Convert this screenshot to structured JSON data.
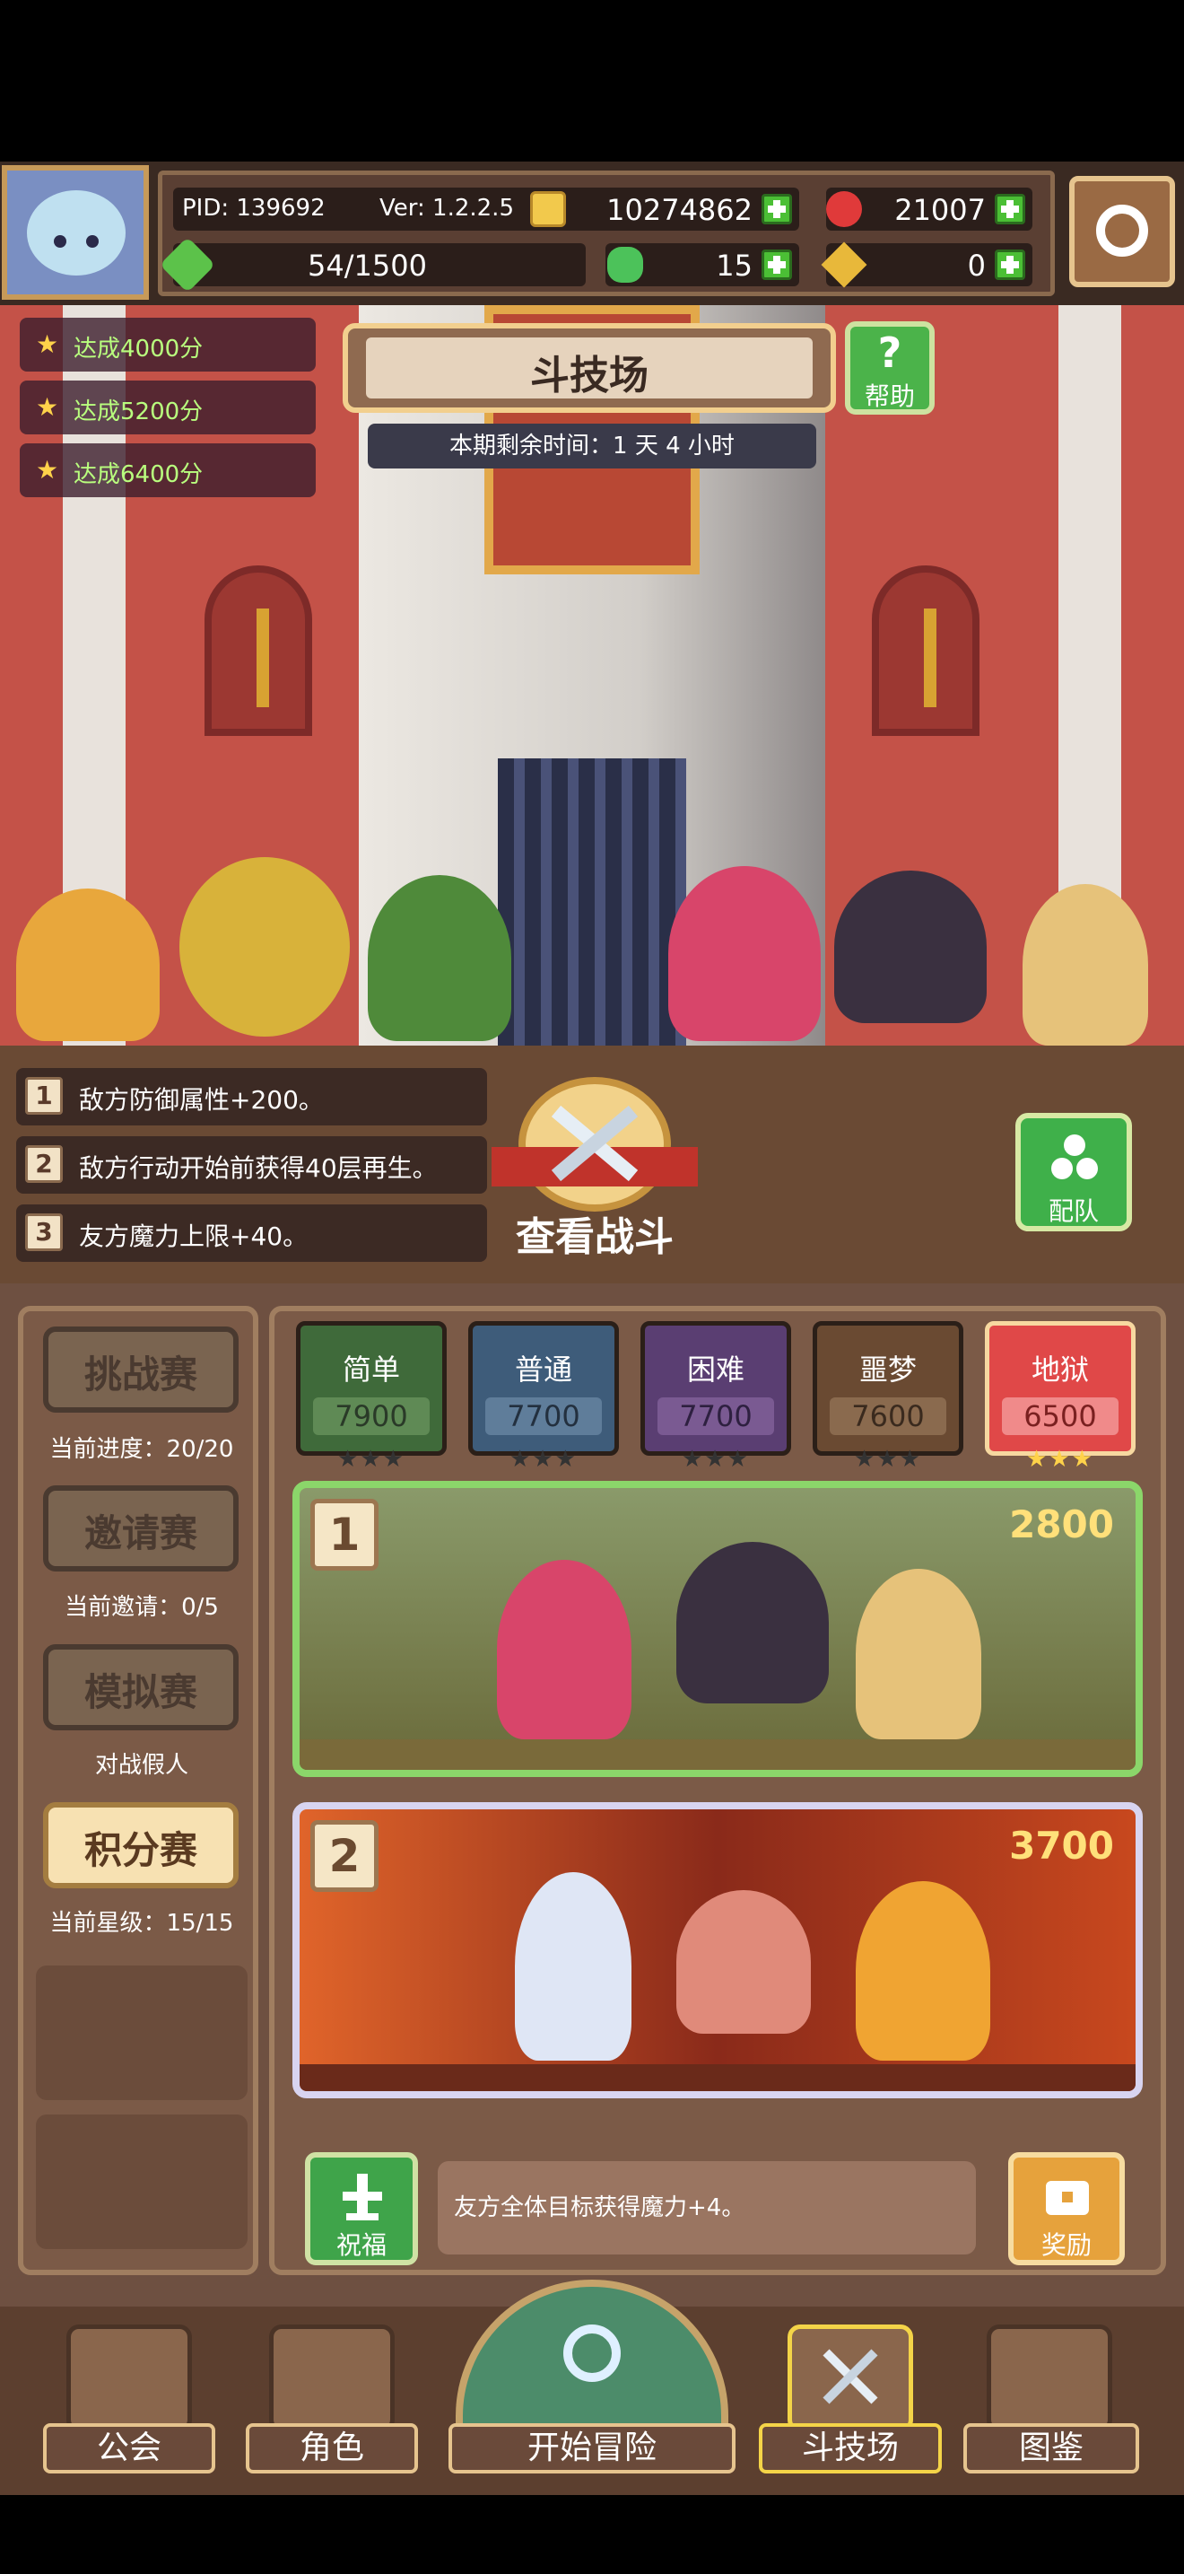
{
  "header": {
    "pid": "PID: 139692",
    "version": "Ver: 1.2.2.5",
    "gold": "10274862",
    "gems": "21007",
    "stamina": "54/1500",
    "clover": "15",
    "key": "0"
  },
  "objectives": [
    "达成4000分",
    "达成5200分",
    "达成6400分"
  ],
  "arena": {
    "title": "斗技场",
    "help_label": "帮助",
    "timer": "本期剩余时间：1 天 4 小时"
  },
  "modifiers": [
    {
      "num": "1",
      "text": "敌方防御属性+200。"
    },
    {
      "num": "2",
      "text": "敌方行动开始前获得40层再生。"
    },
    {
      "num": "3",
      "text": "友方魔力上限+40。"
    }
  ],
  "view_battle_label": "查看战斗",
  "team_label": "配队",
  "modes": [
    {
      "label": "挑战赛",
      "sub": "当前进度：20/20"
    },
    {
      "label": "邀请赛",
      "sub": "当前邀请：0/5"
    },
    {
      "label": "模拟赛",
      "sub": "对战假人"
    },
    {
      "label": "积分赛",
      "sub": "当前星级：15/15"
    }
  ],
  "difficulties": [
    {
      "name": "简单",
      "score": "7900",
      "stars": "★★★"
    },
    {
      "name": "普通",
      "score": "7700",
      "stars": "★★★"
    },
    {
      "name": "困难",
      "score": "7700",
      "stars": "★★★"
    },
    {
      "name": "噩梦",
      "score": "7600",
      "stars": "★★★"
    },
    {
      "name": "地狱",
      "score": "6500",
      "stars": "★★★"
    }
  ],
  "stages": [
    {
      "num": "1",
      "score": "2800"
    },
    {
      "num": "2",
      "score": "3700"
    }
  ],
  "blessing": {
    "label": "祝福",
    "desc": "友方全体目标获得魔力+4。"
  },
  "reward_label": "奖励",
  "nav": {
    "guild": "公会",
    "character": "角色",
    "adventure": "开始冒险",
    "arena": "斗技场",
    "codex": "图鉴"
  }
}
